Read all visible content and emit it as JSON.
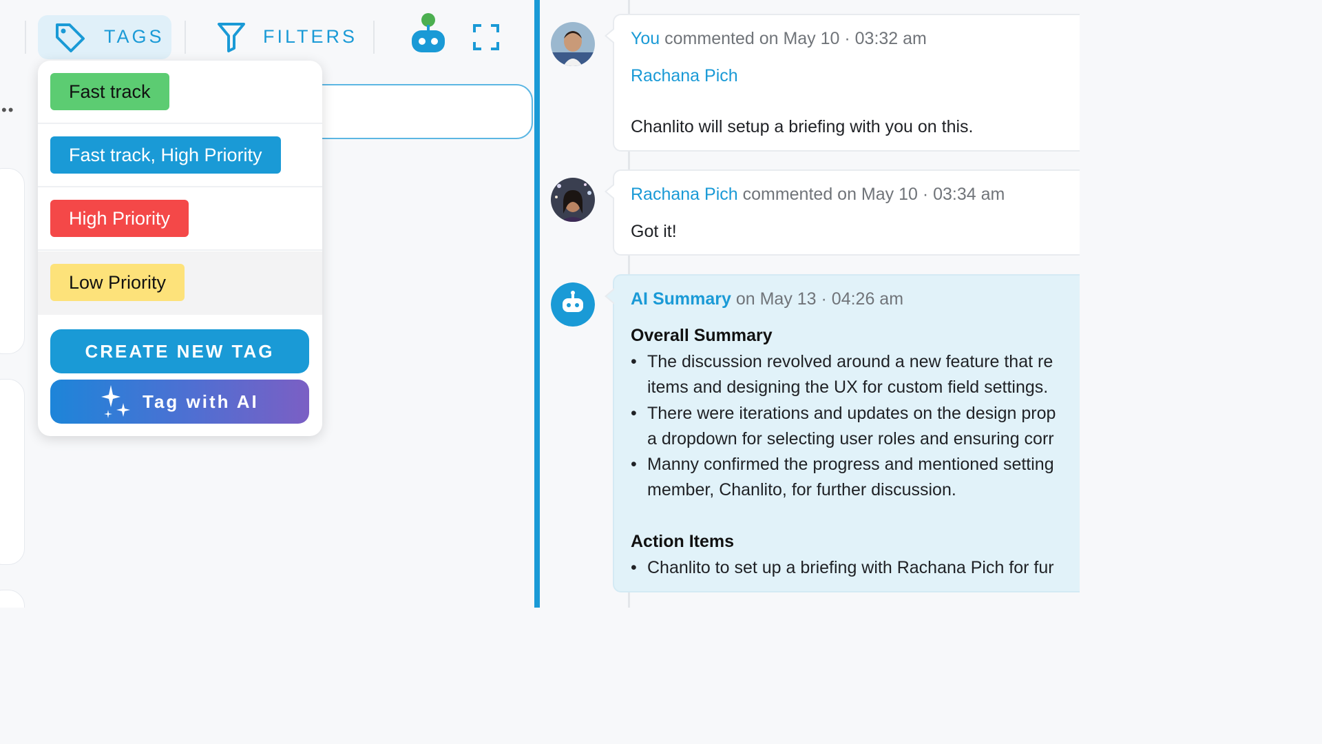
{
  "toolbar": {
    "tags_label": "TAGS",
    "filters_label": "FILTERS"
  },
  "tag_menu": {
    "tags": [
      {
        "label": "Fast track",
        "bg": "#5ccc72",
        "fg": "#111111"
      },
      {
        "label": "Fast track, High Priority",
        "bg": "#1a9ad6",
        "fg": "#ffffff"
      },
      {
        "label": "High Priority",
        "bg": "#f44848",
        "fg": "#ffffff"
      },
      {
        "label": "Low Priority",
        "bg": "#fde27a",
        "fg": "#111111"
      }
    ],
    "create_label": "CREATE NEW TAG",
    "ai_label": "Tag with AI"
  },
  "comments": [
    {
      "author": "You",
      "meta": " commented on May 10 · 03:32 am",
      "mention": "Rachana Pich",
      "text": "Chanlito will setup a briefing with you on this."
    },
    {
      "author": "Rachana Pich",
      "meta": " commented on May 10 · 03:34 am",
      "text": "Got it!"
    }
  ],
  "ai_summary": {
    "author": "AI Summary",
    "meta": " on May 13 · 04:26 am",
    "overall_title": "Overall Summary",
    "bullets": [
      [
        "The discussion revolved around a new feature that re",
        "items and designing the UX for custom field settings."
      ],
      [
        "There were iterations and updates on the design prop",
        "a dropdown for selecting user roles and ensuring corr"
      ],
      [
        "Manny confirmed the progress and mentioned setting",
        "member, Chanlito, for further discussion."
      ]
    ],
    "action_title": "Action Items",
    "actions": [
      "Chanlito to set up a briefing with Rachana Pich for fur"
    ]
  },
  "colors": {
    "accent": "#1a9ad6",
    "ai_panel": "#e1f2f9",
    "robot_head_dot": "#4caf50"
  }
}
